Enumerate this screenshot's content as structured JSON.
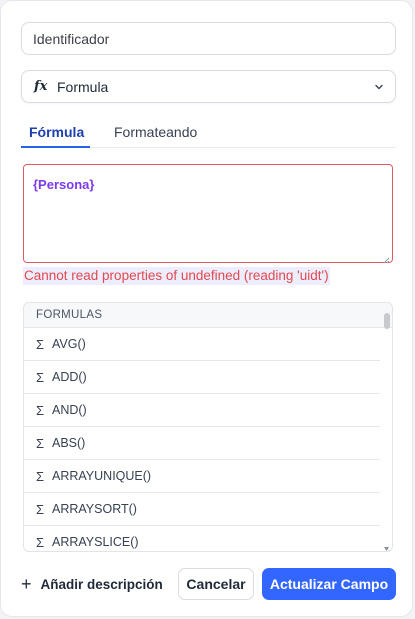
{
  "field_name": {
    "value": "Identificador"
  },
  "field_type": {
    "icon": "fx-icon",
    "label": "Formula",
    "dropdown_icon": "chevron-down-icon"
  },
  "tabs": [
    {
      "label": "Fórmula",
      "active": true
    },
    {
      "label": "Formateando",
      "active": false
    }
  ],
  "editor": {
    "value": "{Persona}"
  },
  "error": {
    "message": "Cannot read properties of undefined (reading 'uidt')"
  },
  "formulas": {
    "header": "FORMULAS",
    "items": [
      {
        "icon": "Σ",
        "label": "AVG()"
      },
      {
        "icon": "Σ",
        "label": "ADD()"
      },
      {
        "icon": "Σ",
        "label": "AND()"
      },
      {
        "icon": "Σ",
        "label": "ABS()"
      },
      {
        "icon": "Σ",
        "label": "ARRAYUNIQUE()"
      },
      {
        "icon": "Σ",
        "label": "ARRAYSORT()"
      },
      {
        "icon": "Σ",
        "label": "ARRAYSLICE()"
      }
    ]
  },
  "footer": {
    "add_description_icon": "+",
    "add_description_label": "Añadir descripción",
    "cancel_label": "Cancelar",
    "save_label": "Actualizar Campo"
  },
  "colors": {
    "accent": "#3366ff",
    "tab_active": "#1e40af",
    "error": "#e5484d",
    "formula_token": "#7c3aed"
  }
}
